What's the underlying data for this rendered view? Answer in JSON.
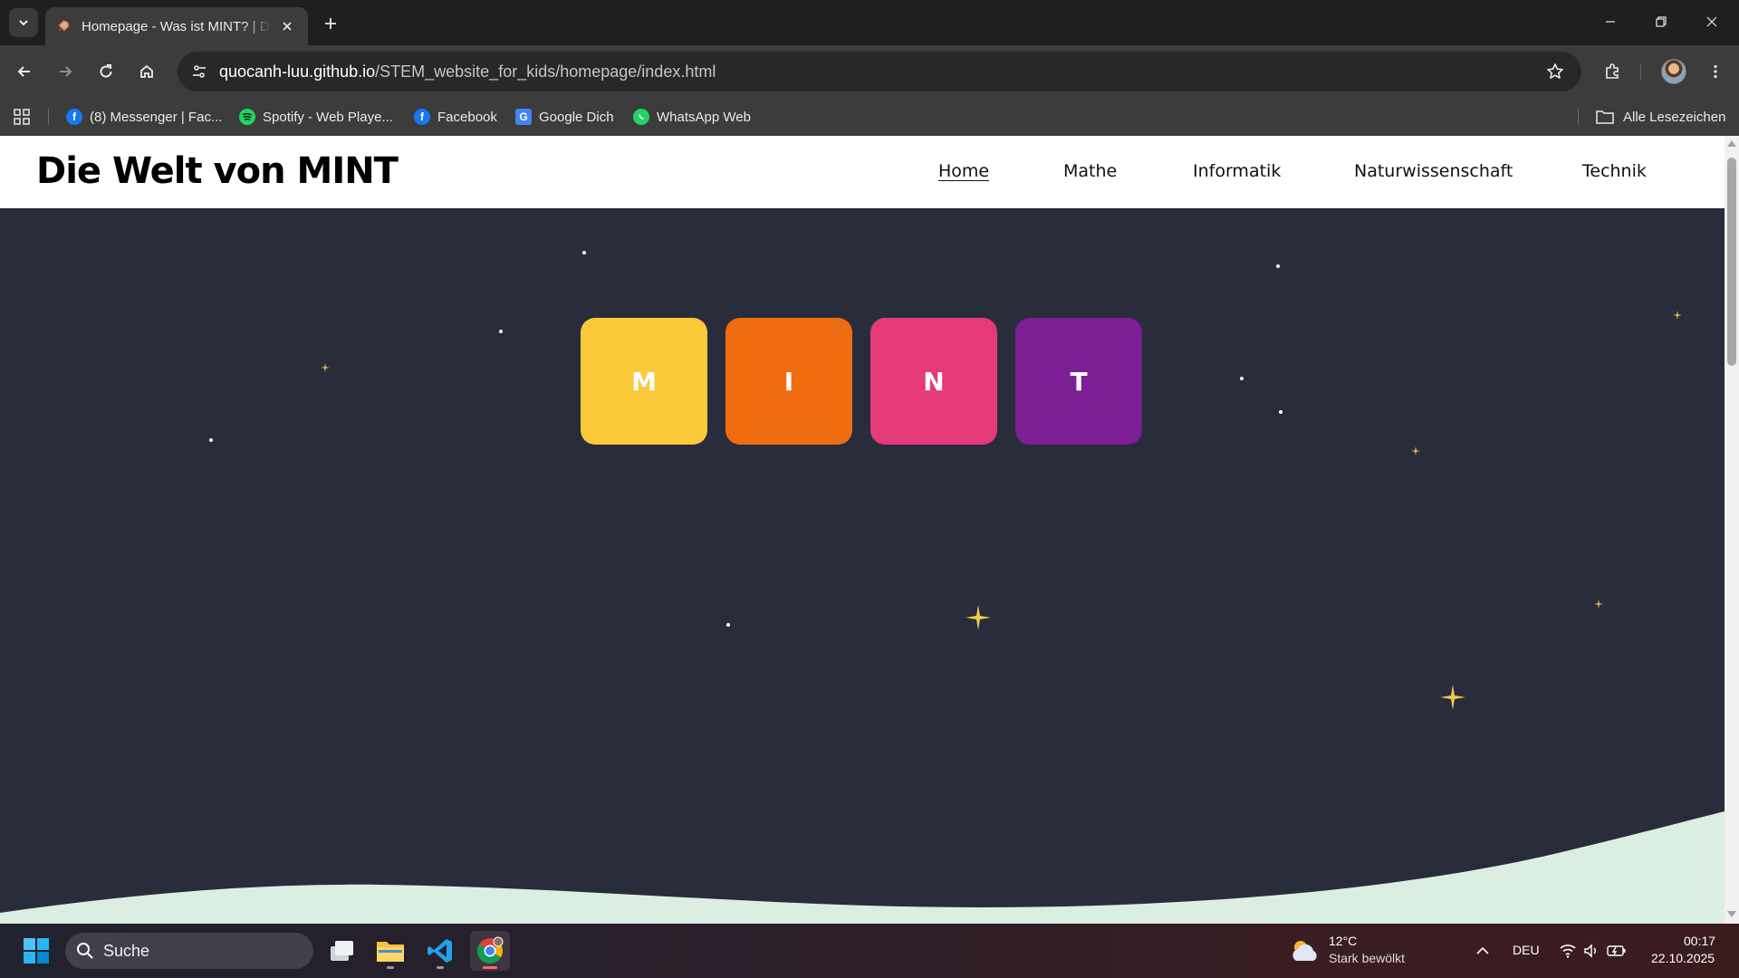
{
  "browser": {
    "tab_title": "Homepage - Was ist MINT? | Die",
    "url_host": "quocanh-luu.github.io",
    "url_path": "/STEM_website_for_kids/homepage/index.html"
  },
  "bookmarks": {
    "items": [
      {
        "label": "(8) Messenger | Fac...",
        "icon": "facebook-icon",
        "color": "#1877f2"
      },
      {
        "label": "Spotify - Web Playe...",
        "icon": "spotify-icon",
        "color": "#1ed760"
      },
      {
        "label": "Facebook",
        "icon": "facebook-icon",
        "color": "#1877f2"
      },
      {
        "label": "Google Dich",
        "icon": "google-translate-icon",
        "color": "#4285f4"
      },
      {
        "label": "WhatsApp Web",
        "icon": "whatsapp-icon",
        "color": "#25d366"
      }
    ],
    "all_bookmarks": "Alle Lesezeichen"
  },
  "site": {
    "logo": "Die Welt von MINT",
    "nav": [
      "Home",
      "Mathe",
      "Informatik",
      "Naturwissenschaft",
      "Technik"
    ],
    "active_nav": "Home",
    "tiles": [
      {
        "letter": "M",
        "color": "#f9c93a"
      },
      {
        "letter": "I",
        "color": "#f06c11"
      },
      {
        "letter": "N",
        "color": "#e5397a"
      },
      {
        "letter": "T",
        "color": "#7c1e94"
      }
    ],
    "background_color": "#292c3a",
    "wave_color": "#dbeee2",
    "star_color": "#f2c94c"
  },
  "taskbar": {
    "search_placeholder": "Suche",
    "weather_temp": "12°C",
    "weather_desc": "Stark bewölkt",
    "language": "DEU",
    "time": "00:17",
    "date": "22.10.2025"
  }
}
